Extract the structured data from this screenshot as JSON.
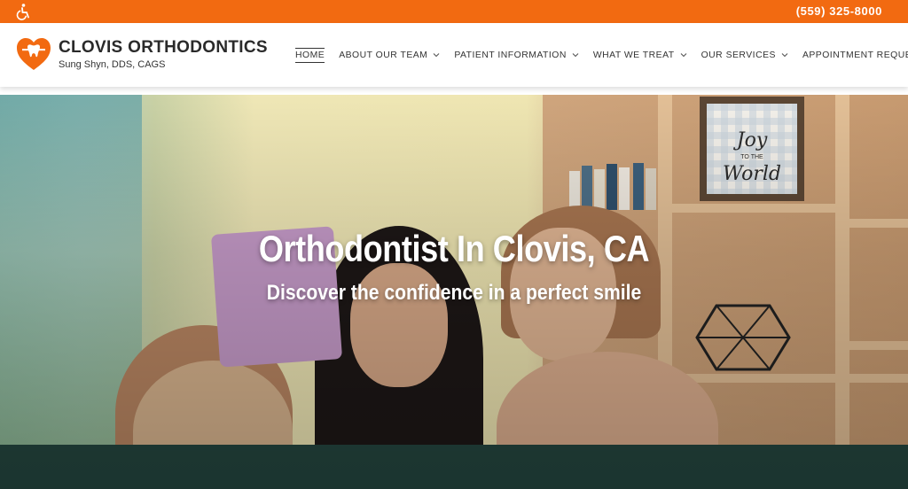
{
  "topbar": {
    "phone": "(559) 325-8000",
    "accessibility_icon": "wheelchair-icon",
    "bg_color": "#f26a11"
  },
  "brand": {
    "name": "CLOVIS ORTHODONTICS",
    "doctor": "Sung Shyn, DDS, CAGS",
    "logo_icon": "heart-tooth-logo"
  },
  "nav": {
    "items": [
      {
        "label": "HOME",
        "active": true
      },
      {
        "label": "ABOUT OUR TEAM",
        "dropdown": true
      },
      {
        "label": "PATIENT INFORMATION",
        "dropdown": true
      },
      {
        "label": "WHAT WE TREAT",
        "dropdown": true
      },
      {
        "label": "OUR SERVICES",
        "dropdown": true
      },
      {
        "label": "APPOINTMENT REQUEST",
        "dropdown": true
      }
    ]
  },
  "hero": {
    "title": "Orthodontist In Clovis, CA",
    "subtitle": "Discover the confidence in a perfect smile",
    "sign_text": "Joy to the World"
  }
}
